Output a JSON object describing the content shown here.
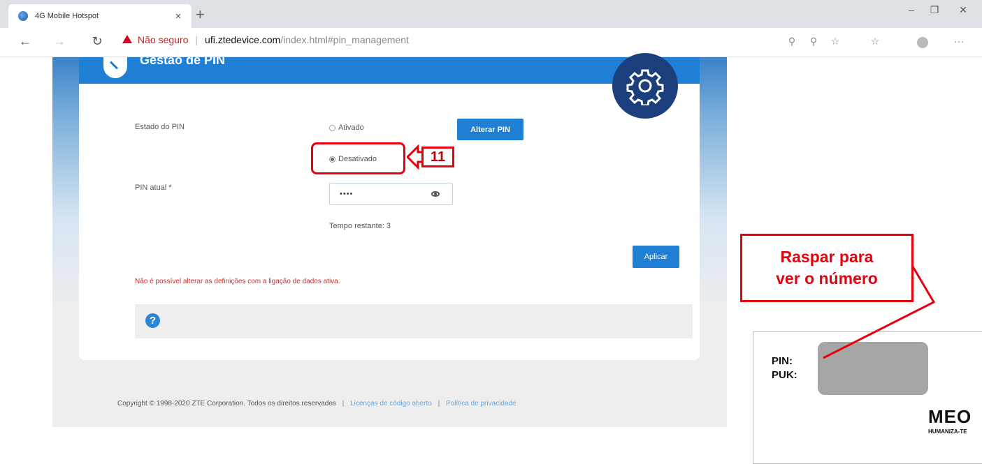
{
  "browser": {
    "tab_title": "4G Mobile Hotspot",
    "not_secure_label": "Não seguro",
    "url_host": "ufi.ztedevice.com",
    "url_path": "/index.html#pin_management"
  },
  "page": {
    "header_title": "Gestão de PIN",
    "pin_state_label": "Estado do PIN",
    "option_enabled": "Ativado",
    "option_disabled": "Desativado",
    "change_pin_button": "Alterar PIN",
    "current_pin_label": "PIN atual *",
    "current_pin_value": "••••",
    "remaining_attempts": "Tempo restante: 3",
    "apply_button": "Aplicar",
    "error_message": "Não é possível alterar as definições com a ligação de dados ativa.",
    "help_symbol": "?"
  },
  "footer": {
    "copyright": "Copyright © 1998-2020 ZTE Corporation. Todos os direitos reservados",
    "open_source_link": "Licenças de código aberto",
    "privacy_link": "Política de privacidade"
  },
  "annotation": {
    "step_number": "11",
    "callout_line1": "Raspar para",
    "callout_line2": "ver o número",
    "accent_color": "#e8000d"
  },
  "sim_card": {
    "pin_label": "PIN:",
    "puk_label": "PUK:",
    "logo_text": "MEO",
    "tagline": "HUMANIZA-TE"
  },
  "icons": [
    "favicon-icon",
    "close-icon",
    "new-tab-icon",
    "back-icon",
    "forward-icon",
    "refresh-icon",
    "warning-icon",
    "zoom-out-icon",
    "zoom-in-icon",
    "favorite-icon",
    "favorites-icon",
    "profile-icon",
    "more-icon",
    "gear-icon",
    "eye-icon",
    "help-icon"
  ]
}
